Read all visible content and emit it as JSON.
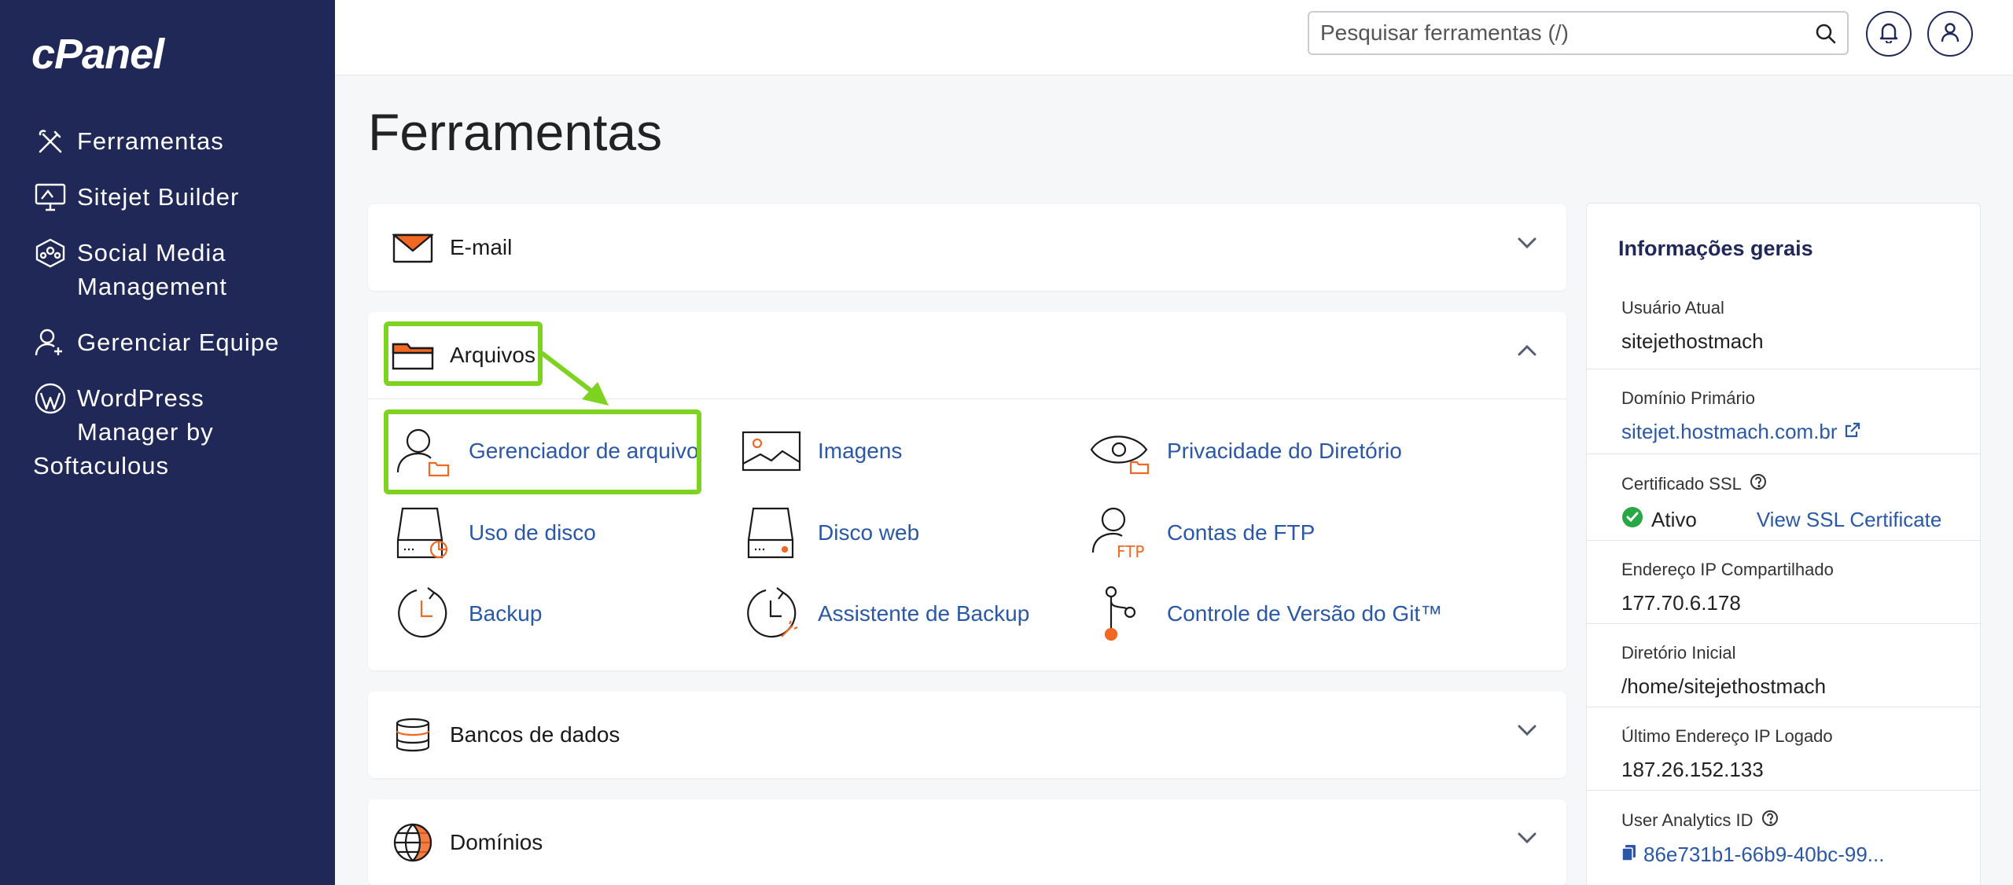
{
  "sidebar": {
    "logo": "cPanel",
    "items": [
      {
        "label": "Ferramentas",
        "icon": "tools-icon"
      },
      {
        "label": "Sitejet Builder",
        "icon": "sitejet-icon"
      },
      {
        "label": "Social Media\nManagement",
        "icon": "social-media-icon"
      },
      {
        "label": "Gerenciar Equipe",
        "icon": "team-icon"
      },
      {
        "label": "WordPress\n  Manager by",
        "icon": "wordpress-icon",
        "extra": "Softaculous"
      }
    ]
  },
  "header": {
    "search_placeholder": "Pesquisar ferramentas (/)"
  },
  "main": {
    "title": "Ferramentas",
    "categories": [
      {
        "label": "E-mail",
        "icon": "email-icon",
        "expanded": false
      },
      {
        "label": "Arquivos",
        "icon": "folder-icon",
        "expanded": true,
        "tools": [
          {
            "label": "Gerenciador de arquivo",
            "icon": "file-manager-icon"
          },
          {
            "label": "Imagens",
            "icon": "images-icon"
          },
          {
            "label": "Privacidade do Diretório",
            "icon": "directory-privacy-icon"
          },
          {
            "label": "Uso de disco",
            "icon": "disk-usage-icon"
          },
          {
            "label": "Disco web",
            "icon": "web-disk-icon"
          },
          {
            "label": "Contas de FTP",
            "icon": "ftp-accounts-icon"
          },
          {
            "label": "Backup",
            "icon": "backup-icon"
          },
          {
            "label": "Assistente de Backup",
            "icon": "backup-wizard-icon"
          },
          {
            "label": "Controle de Versão do Git™",
            "icon": "git-icon"
          }
        ]
      },
      {
        "label": "Bancos de dados",
        "icon": "database-icon",
        "expanded": false
      },
      {
        "label": "Domínios",
        "icon": "globe-icon",
        "expanded": false
      }
    ]
  },
  "info": {
    "title": "Informações gerais",
    "rows": [
      {
        "label": "Usuário Atual",
        "value": "sitejethostmach"
      },
      {
        "label": "Domínio Primário",
        "value": "sitejet.hostmach.com.br"
      },
      {
        "label": "Certificado SSL",
        "value": "Ativo",
        "link": "View SSL Certificate"
      },
      {
        "label": "Endereço IP Compartilhado",
        "value": "177.70.6.178"
      },
      {
        "label": "Diretório Inicial",
        "value": "/home/sitejethostmach"
      },
      {
        "label": "Último Endereço IP Logado",
        "value": "187.26.152.133"
      },
      {
        "label": "User Analytics ID",
        "value": "86e731b1-66b9-40bc-99..."
      }
    ]
  },
  "colors": {
    "sidebar_bg": "#1f2857",
    "accent_orange": "#f26722",
    "link_blue": "#2a58a6",
    "highlight_green": "#7ed321",
    "ssl_green": "#28a745"
  }
}
